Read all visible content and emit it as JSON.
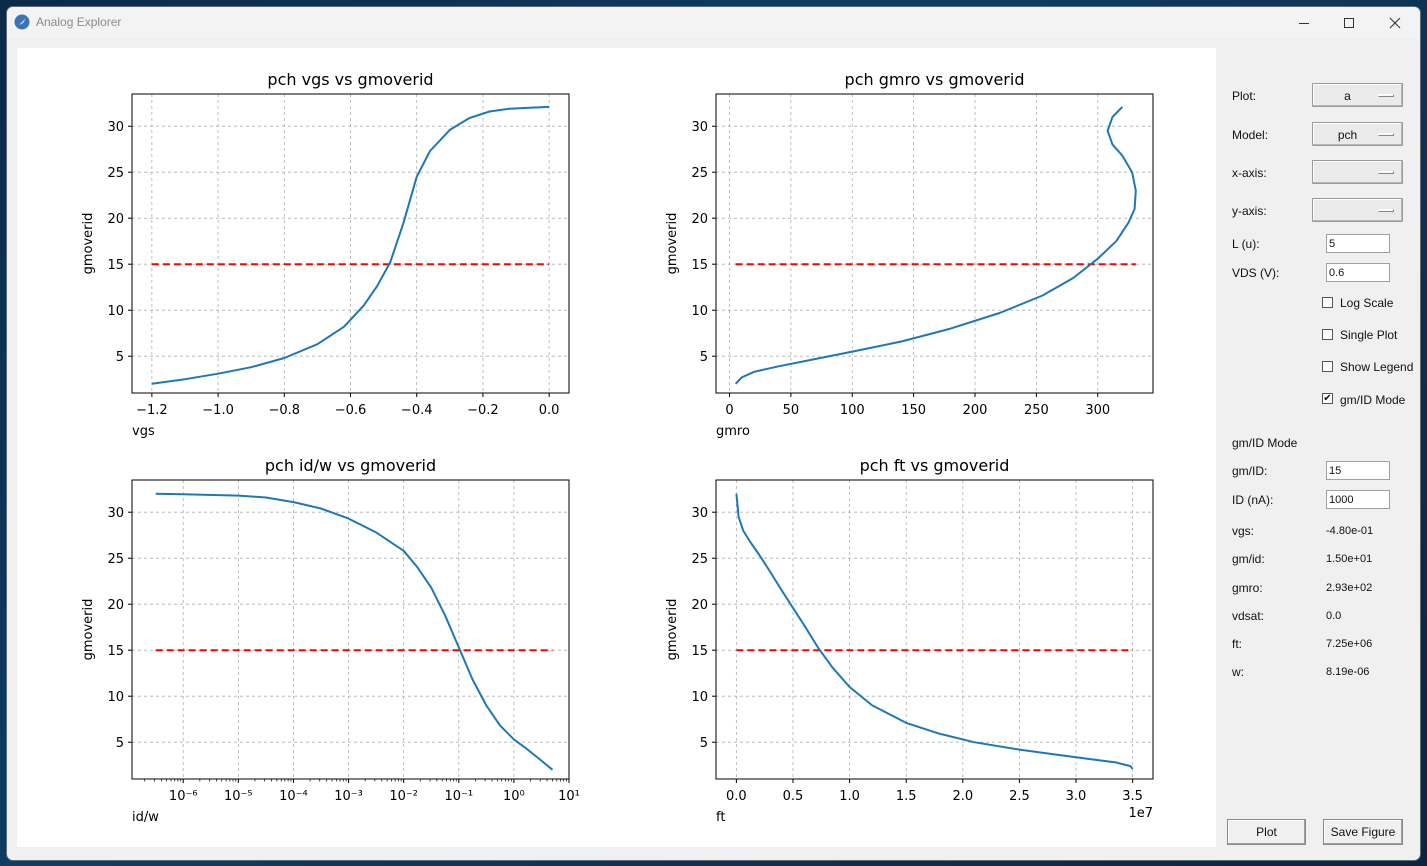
{
  "window": {
    "title": "Analog Explorer"
  },
  "controls": {
    "plot_label": "Plot:",
    "plot_value": "a",
    "model_label": "Model:",
    "model_value": "pch",
    "xaxis_label": "x-axis:",
    "xaxis_value": "",
    "yaxis_label": "y-axis:",
    "yaxis_value": "",
    "l_label": "L (u):",
    "l_value": "5",
    "vds_label": "VDS (V):",
    "vds_value": "0.6",
    "log_scale": {
      "label": "Log Scale",
      "checked": false
    },
    "single_plot": {
      "label": "Single Plot",
      "checked": false
    },
    "show_legend": {
      "label": "Show Legend",
      "checked": false
    },
    "gmid_mode": {
      "label": "gm/ID Mode",
      "checked": true
    }
  },
  "gmid_section": {
    "title": "gm/ID Mode",
    "gmid_label": "gm/ID:",
    "gmid_value": "15",
    "id_label": "ID (nA):",
    "id_value": "1000",
    "results": [
      {
        "label": "vgs:",
        "value": "-4.80e-01"
      },
      {
        "label": "gm/id:",
        "value": "1.50e+01"
      },
      {
        "label": "gmro:",
        "value": "2.93e+02"
      },
      {
        "label": "vdsat:",
        "value": "0.0"
      },
      {
        "label": "ft:",
        "value": "7.25e+06"
      },
      {
        "label": "w:",
        "value": "8.19e-06"
      }
    ]
  },
  "buttons": {
    "plot": "Plot",
    "save": "Save Figure"
  },
  "colors": {
    "line": "#1f77b4",
    "ref": "#ff0000",
    "grid": "#b0b0b0"
  },
  "chart_data": [
    {
      "type": "line",
      "title": "pch vgs vs gmoverid",
      "xlabel": "vgs",
      "ylabel": "gmoverid",
      "xlim": [
        -1.26,
        0.06
      ],
      "ylim": [
        1.0,
        33.5
      ],
      "xscale": "linear",
      "xticks": [
        -1.2,
        -1.0,
        -0.8,
        -0.6,
        -0.4,
        -0.2,
        0.0
      ],
      "xticklabels": [
        "−1.2",
        "−1.0",
        "−0.8",
        "−0.6",
        "−0.4",
        "−0.2",
        "0.0"
      ],
      "yticks": [
        5,
        10,
        15,
        20,
        25,
        30
      ],
      "yticklabels": [
        "5",
        "10",
        "15",
        "20",
        "25",
        "30"
      ],
      "grid": true,
      "series": [
        {
          "x": [
            -1.2,
            -1.1,
            -1.0,
            -0.9,
            -0.8,
            -0.7,
            -0.62,
            -0.56,
            -0.52,
            -0.48,
            -0.44,
            -0.4,
            -0.36,
            -0.3,
            -0.24,
            -0.18,
            -0.12,
            -0.06,
            0.0
          ],
          "y": [
            2.0,
            2.5,
            3.1,
            3.8,
            4.8,
            6.3,
            8.2,
            10.5,
            12.6,
            15.2,
            19.5,
            24.5,
            27.3,
            29.6,
            30.9,
            31.6,
            31.9,
            32.0,
            32.1
          ]
        }
      ],
      "reference": {
        "y": 15,
        "x": [
          -1.2,
          0.0
        ]
      }
    },
    {
      "type": "line",
      "title": "pch gmro vs gmoverid",
      "xlabel": "gmro",
      "ylabel": "gmoverid",
      "xlim": [
        -11,
        345
      ],
      "ylim": [
        1.0,
        33.5
      ],
      "xscale": "linear",
      "xticks": [
        0,
        50,
        100,
        150,
        200,
        250,
        300
      ],
      "xticklabels": [
        "0",
        "50",
        "100",
        "150",
        "200",
        "250",
        "300"
      ],
      "yticks": [
        5,
        10,
        15,
        20,
        25,
        30
      ],
      "yticklabels": [
        "5",
        "10",
        "15",
        "20",
        "25",
        "30"
      ],
      "grid": true,
      "series": [
        {
          "x": [
            5,
            10,
            20,
            40,
            70,
            100,
            140,
            180,
            220,
            255,
            280,
            300,
            315,
            325,
            330,
            331,
            328,
            320,
            312,
            308,
            312,
            320
          ],
          "y": [
            2.0,
            2.7,
            3.3,
            3.9,
            4.7,
            5.5,
            6.6,
            8.0,
            9.7,
            11.6,
            13.5,
            15.6,
            17.5,
            19.5,
            21.0,
            23.0,
            25.0,
            26.8,
            28.0,
            29.5,
            31.0,
            32.1
          ]
        }
      ],
      "reference": {
        "y": 15,
        "x": [
          5,
          331
        ]
      }
    },
    {
      "type": "line",
      "title": "pch id/w vs gmoverid",
      "xlabel": "id/w",
      "ylabel": "gmoverid",
      "xlim": [
        -6.93,
        1.0
      ],
      "ylim": [
        1.0,
        33.5
      ],
      "xscale": "log10",
      "xticks": [
        -6,
        -5,
        -4,
        -3,
        -2,
        -1,
        0,
        1
      ],
      "xticklabels": [
        "10⁻⁶",
        "10⁻⁵",
        "10⁻⁴",
        "10⁻³",
        "10⁻²",
        "10⁻¹",
        "10⁰",
        "10¹"
      ],
      "yticks": [
        5,
        10,
        15,
        20,
        25,
        30
      ],
      "yticklabels": [
        "5",
        "10",
        "15",
        "20",
        "25",
        "30"
      ],
      "grid": true,
      "series": [
        {
          "x": [
            -6.5,
            -6.0,
            -5.0,
            -4.5,
            -4.0,
            -3.5,
            -3.0,
            -2.5,
            -2.0,
            -1.75,
            -1.5,
            -1.25,
            -1.0,
            -0.75,
            -0.5,
            -0.25,
            0.0,
            0.25,
            0.5,
            0.7
          ],
          "y": [
            32.0,
            31.95,
            31.8,
            31.6,
            31.1,
            30.4,
            29.3,
            27.8,
            25.8,
            24.0,
            21.8,
            18.8,
            15.3,
            11.8,
            9.0,
            6.8,
            5.3,
            4.2,
            3.0,
            2.0
          ]
        }
      ],
      "reference": {
        "y": 15,
        "x": [
          -6.5,
          0.7
        ]
      }
    },
    {
      "type": "line",
      "title": "pch ft vs gmoverid",
      "xlabel": "ft",
      "ylabel": "gmoverid",
      "xlim": [
        -0.18,
        3.68
      ],
      "ylim": [
        1.0,
        33.5
      ],
      "xscale": "linear",
      "xticks": [
        0.0,
        0.5,
        1.0,
        1.5,
        2.0,
        2.5,
        3.0,
        3.5
      ],
      "xticklabels": [
        "0.0",
        "0.5",
        "1.0",
        "1.5",
        "2.0",
        "2.5",
        "3.0",
        "3.5"
      ],
      "yticks": [
        5,
        10,
        15,
        20,
        25,
        30
      ],
      "yticklabels": [
        "5",
        "10",
        "15",
        "20",
        "25",
        "30"
      ],
      "offset_text": "1e7",
      "grid": true,
      "series": [
        {
          "x": [
            0.0,
            0.02,
            0.06,
            0.12,
            0.2,
            0.3,
            0.4,
            0.5,
            0.6,
            0.72,
            0.85,
            1.0,
            1.2,
            1.5,
            1.8,
            2.1,
            2.5,
            2.8,
            3.1,
            3.35,
            3.48,
            3.5
          ],
          "y": [
            32.0,
            29.5,
            28.0,
            26.8,
            25.4,
            23.5,
            21.5,
            19.6,
            17.7,
            15.3,
            13.1,
            11.0,
            9.0,
            7.1,
            5.9,
            5.0,
            4.2,
            3.7,
            3.2,
            2.8,
            2.4,
            2.1
          ]
        }
      ],
      "reference": {
        "y": 15,
        "x": [
          0.0,
          3.5
        ]
      }
    }
  ]
}
